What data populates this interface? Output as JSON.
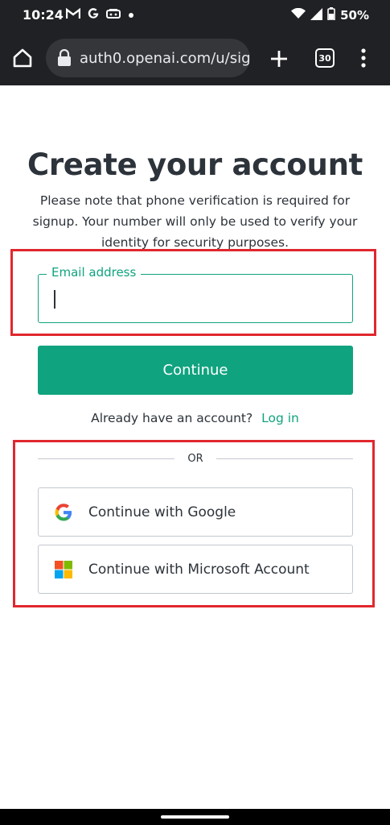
{
  "status_bar": {
    "time": "10:24",
    "battery": "50%",
    "left_icons": [
      "gmail-icon",
      "google-icon",
      "game-icon",
      "dot-icon"
    ],
    "right_icons": [
      "wifi-icon",
      "signal-icon",
      "battery-icon"
    ]
  },
  "browser": {
    "url": "auth0.openai.com/u/sig",
    "tab_count": "30"
  },
  "page": {
    "title": "Create your account",
    "note": "Please note that phone verification is required for signup. Your number will only be used to verify your identity for security purposes.",
    "email_label": "Email address",
    "email_value": "",
    "continue_label": "Continue",
    "login_prompt": "Already have an account?",
    "login_link": "Log in",
    "or_text": "OR",
    "google_label": "Continue with Google",
    "microsoft_label": "Continue with Microsoft Account"
  },
  "colors": {
    "accent": "#10a37f",
    "highlight": "#e0282e",
    "toolbar": "#202124"
  }
}
